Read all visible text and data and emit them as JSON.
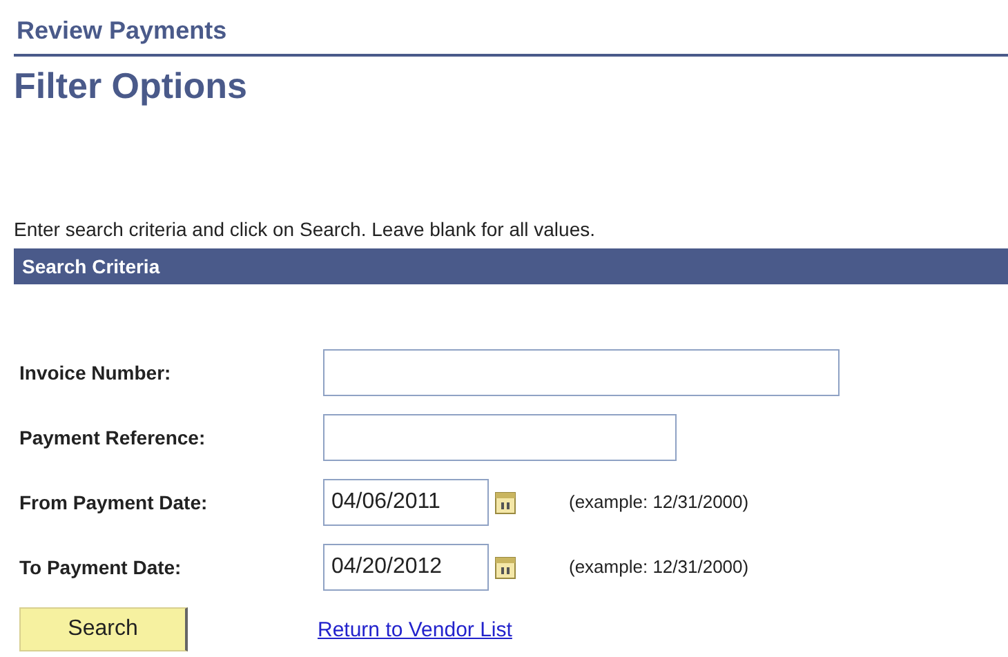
{
  "page_title": "Review Payments",
  "heading": "Filter Options",
  "instructions": "Enter search criteria and click on Search. Leave blank for all values.",
  "section": {
    "title": "Search Criteria"
  },
  "fields": [
    {
      "label": "Invoice Number:",
      "kind": "text"
    },
    {
      "label": "Payment Reference:",
      "kind": "text"
    },
    {
      "label": "From Payment Date:",
      "kind": "date",
      "value": "04/06/2011",
      "example": "(example: 12/31/2000)"
    },
    {
      "label": "To Payment Date:",
      "kind": "date",
      "value": "04/20/2012",
      "example": "(example: 12/31/2000)"
    }
  ],
  "search_button": "Search",
  "link": "Return to Vendor List"
}
